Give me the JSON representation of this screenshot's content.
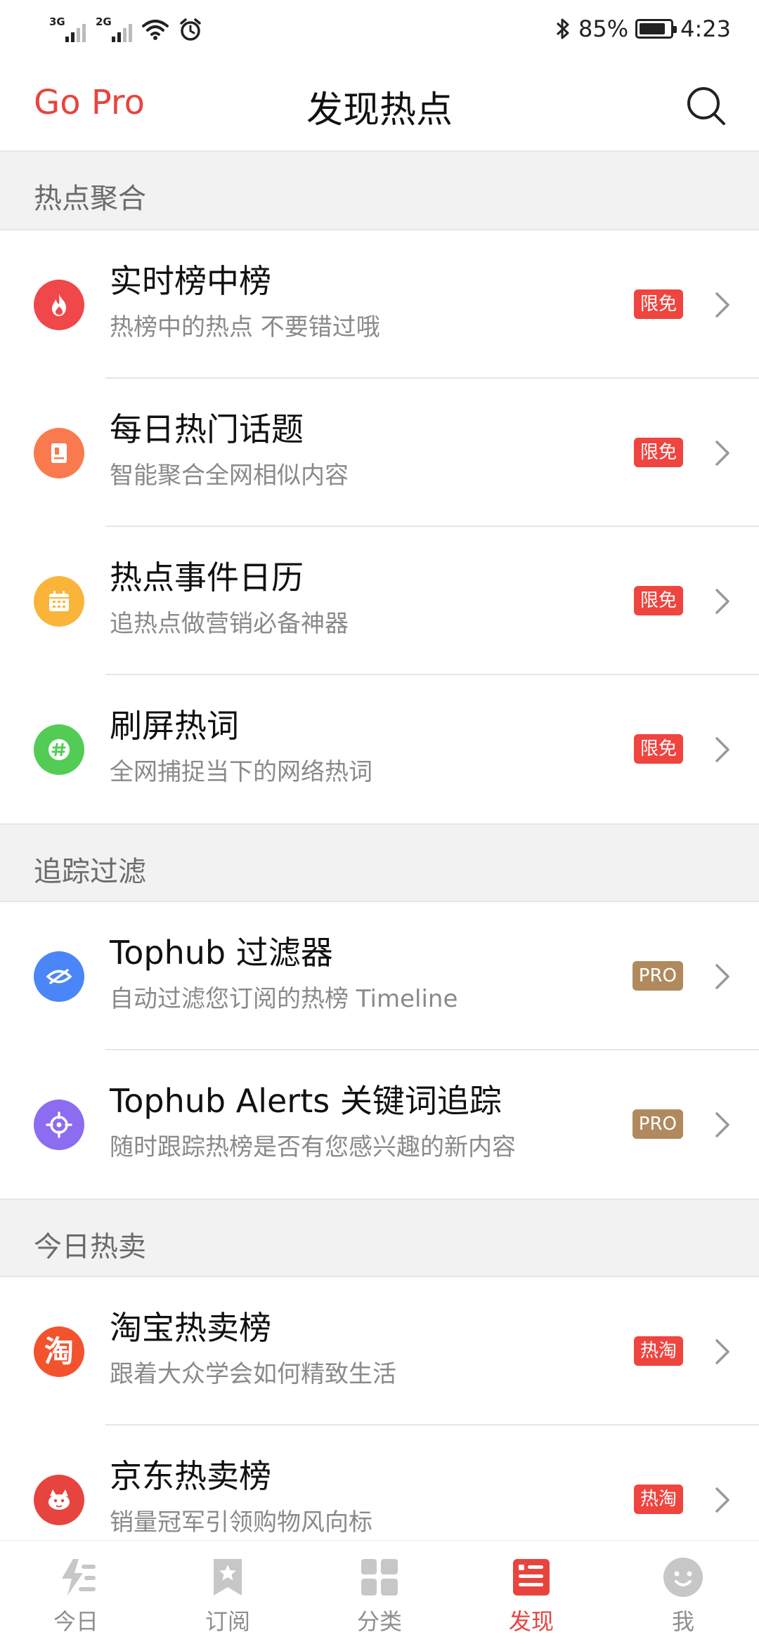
{
  "status_bar": {
    "net1": "3G",
    "net2": "2G",
    "battery_percent": "85%",
    "battery_level": 0.85,
    "time": "4:23"
  },
  "header": {
    "go_pro": "Go Pro",
    "title": "发现热点"
  },
  "sections": [
    {
      "title": "热点聚合",
      "items": [
        {
          "title": "实时榜中榜",
          "subtitle": "热榜中的热点 不要错过哦",
          "badge": "限免",
          "icon": "flame-icon",
          "color": "#f0474a"
        },
        {
          "title": "每日热门话题",
          "subtitle": "智能聚合全网相似内容",
          "badge": "限免",
          "icon": "bookmark-doc-icon",
          "color": "#f97a4e"
        },
        {
          "title": "热点事件日历",
          "subtitle": "追热点做营销必备神器",
          "badge": "限免",
          "icon": "calendar-icon",
          "color": "#fbb43a"
        },
        {
          "title": "刷屏热词",
          "subtitle": "全网捕捉当下的网络热词",
          "badge": "限免",
          "icon": "hashtag-icon",
          "color": "#52cc55"
        }
      ]
    },
    {
      "title": "追踪过滤",
      "items": [
        {
          "title": "Tophub 过滤器",
          "subtitle": "自动过滤您订阅的热榜 Timeline",
          "badge": "PRO",
          "icon": "eye-off-icon",
          "color": "#4a86f7"
        },
        {
          "title": "Tophub Alerts 关键词追踪",
          "subtitle": "随时跟踪热榜是否有您感兴趣的新内容",
          "badge": "PRO",
          "icon": "target-icon",
          "color": "#8c6cf0"
        }
      ]
    },
    {
      "title": "今日热卖",
      "items": [
        {
          "title": "淘宝热卖榜",
          "subtitle": "跟着大众学会如何精致生活",
          "badge": "热淘",
          "icon": "taobao-icon",
          "glyph": "淘",
          "color": "#f2532d"
        },
        {
          "title": "京东热卖榜",
          "subtitle": "销量冠军引领购物风向标",
          "badge": "热淘",
          "icon": "jd-dog-icon",
          "color": "#e8443f"
        }
      ]
    }
  ],
  "tabs": [
    {
      "label": "今日",
      "icon": "today-icon"
    },
    {
      "label": "订阅",
      "icon": "star-bookmark-icon"
    },
    {
      "label": "分类",
      "icon": "grid-icon"
    },
    {
      "label": "发现",
      "icon": "discover-icon",
      "active": true
    },
    {
      "label": "我",
      "icon": "smile-avatar-icon"
    }
  ]
}
